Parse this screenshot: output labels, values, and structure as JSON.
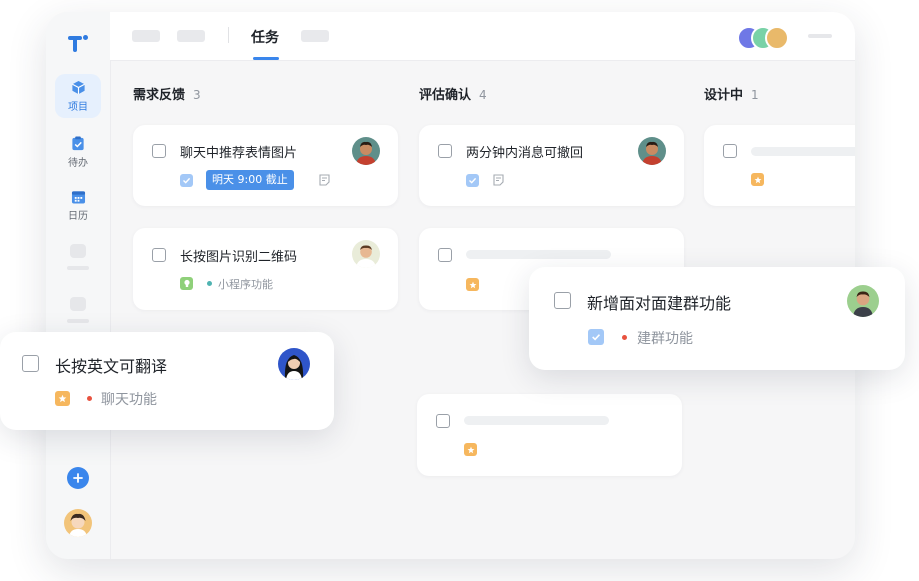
{
  "sidebar": {
    "items": [
      {
        "label": "项目",
        "icon": "cube-icon",
        "active": true
      },
      {
        "label": "待办",
        "icon": "clipboard-check-icon",
        "active": false
      },
      {
        "label": "日历",
        "icon": "calendar-icon",
        "active": false
      }
    ]
  },
  "topbar": {
    "active_tab": "任务"
  },
  "columns": [
    {
      "title": "需求反馈",
      "count": "3"
    },
    {
      "title": "评估确认",
      "count": "4"
    },
    {
      "title": "设计中",
      "count": "1"
    }
  ],
  "cards": {
    "c1": {
      "title": "聊天中推荐表情图片",
      "due": "明天 9:00 截止"
    },
    "c2": {
      "title": "长按图片识别二维码",
      "tag": "小程序功能"
    },
    "c3": {
      "title": "两分钟内消息可撤回"
    }
  },
  "floating": {
    "f1": {
      "title": "长按英文可翻译",
      "tag": "聊天功能"
    },
    "f2": {
      "title": "新增面对面建群功能",
      "tag": "建群功能"
    }
  },
  "colors": {
    "accent": "#3a86ec",
    "due_badge": "#4a90e8",
    "star_badge": "#f6b75e",
    "tag_red": "#e8523f",
    "tag_teal": "#4fb3b1"
  }
}
